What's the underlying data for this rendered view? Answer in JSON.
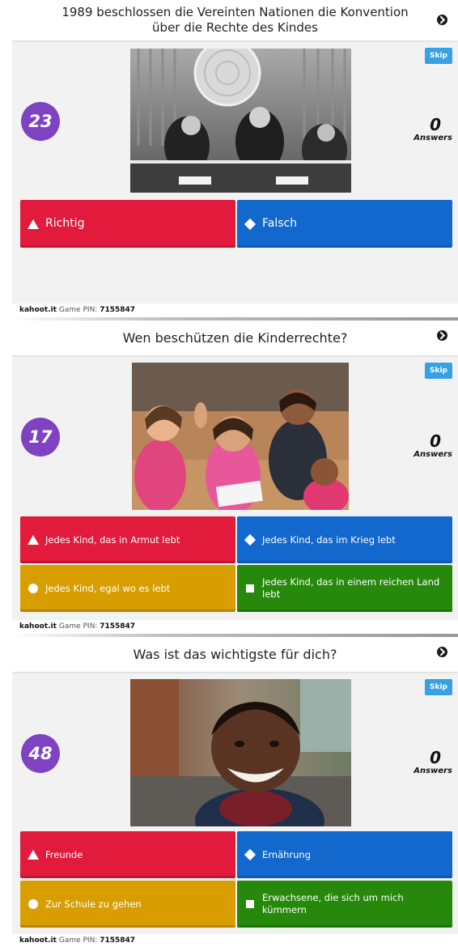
{
  "footer": {
    "site": "kahoot.it",
    "pin_label": "Game PIN:",
    "pin": "7155847"
  },
  "questions": [
    {
      "title": "1989 beschlossen die Vereinten Nationen die Konvention über die Rechte des Kindes",
      "timer": "23",
      "answers_count": "0",
      "answers_label": "Answers",
      "skip_label": "Skip",
      "choices": [
        {
          "label": "Richtig",
          "shape": "triangle",
          "color": "#e21b3c"
        },
        {
          "label": "Falsch",
          "shape": "diamond",
          "color": "#1368ce"
        }
      ]
    },
    {
      "title": "Wen beschützen die Kinderrechte?",
      "timer": "17",
      "answers_count": "0",
      "answers_label": "Answers",
      "skip_label": "Skip",
      "choices": [
        {
          "label": "Jedes Kind, das in Armut lebt",
          "shape": "triangle",
          "color": "#e21b3c"
        },
        {
          "label": "Jedes Kind, das im Krieg lebt",
          "shape": "diamond",
          "color": "#1368ce"
        },
        {
          "label": "Jedes Kind, egal wo es lebt",
          "shape": "circle",
          "color": "#d89e00"
        },
        {
          "label": "Jedes Kind, das in einem reichen Land lebt",
          "shape": "square",
          "color": "#26890c"
        }
      ]
    },
    {
      "title": "Was ist das wichtigste für dich?",
      "timer": "48",
      "answers_count": "0",
      "answers_label": "Answers",
      "skip_label": "Skip",
      "choices": [
        {
          "label": "Freunde",
          "shape": "triangle",
          "color": "#e21b3c"
        },
        {
          "label": "Ernährung",
          "shape": "diamond",
          "color": "#1368ce"
        },
        {
          "label": "Zur Schule zu gehen",
          "shape": "circle",
          "color": "#d89e00"
        },
        {
          "label": "Erwachsene, die sich um mich kümmern",
          "shape": "square",
          "color": "#26890c"
        }
      ]
    }
  ]
}
